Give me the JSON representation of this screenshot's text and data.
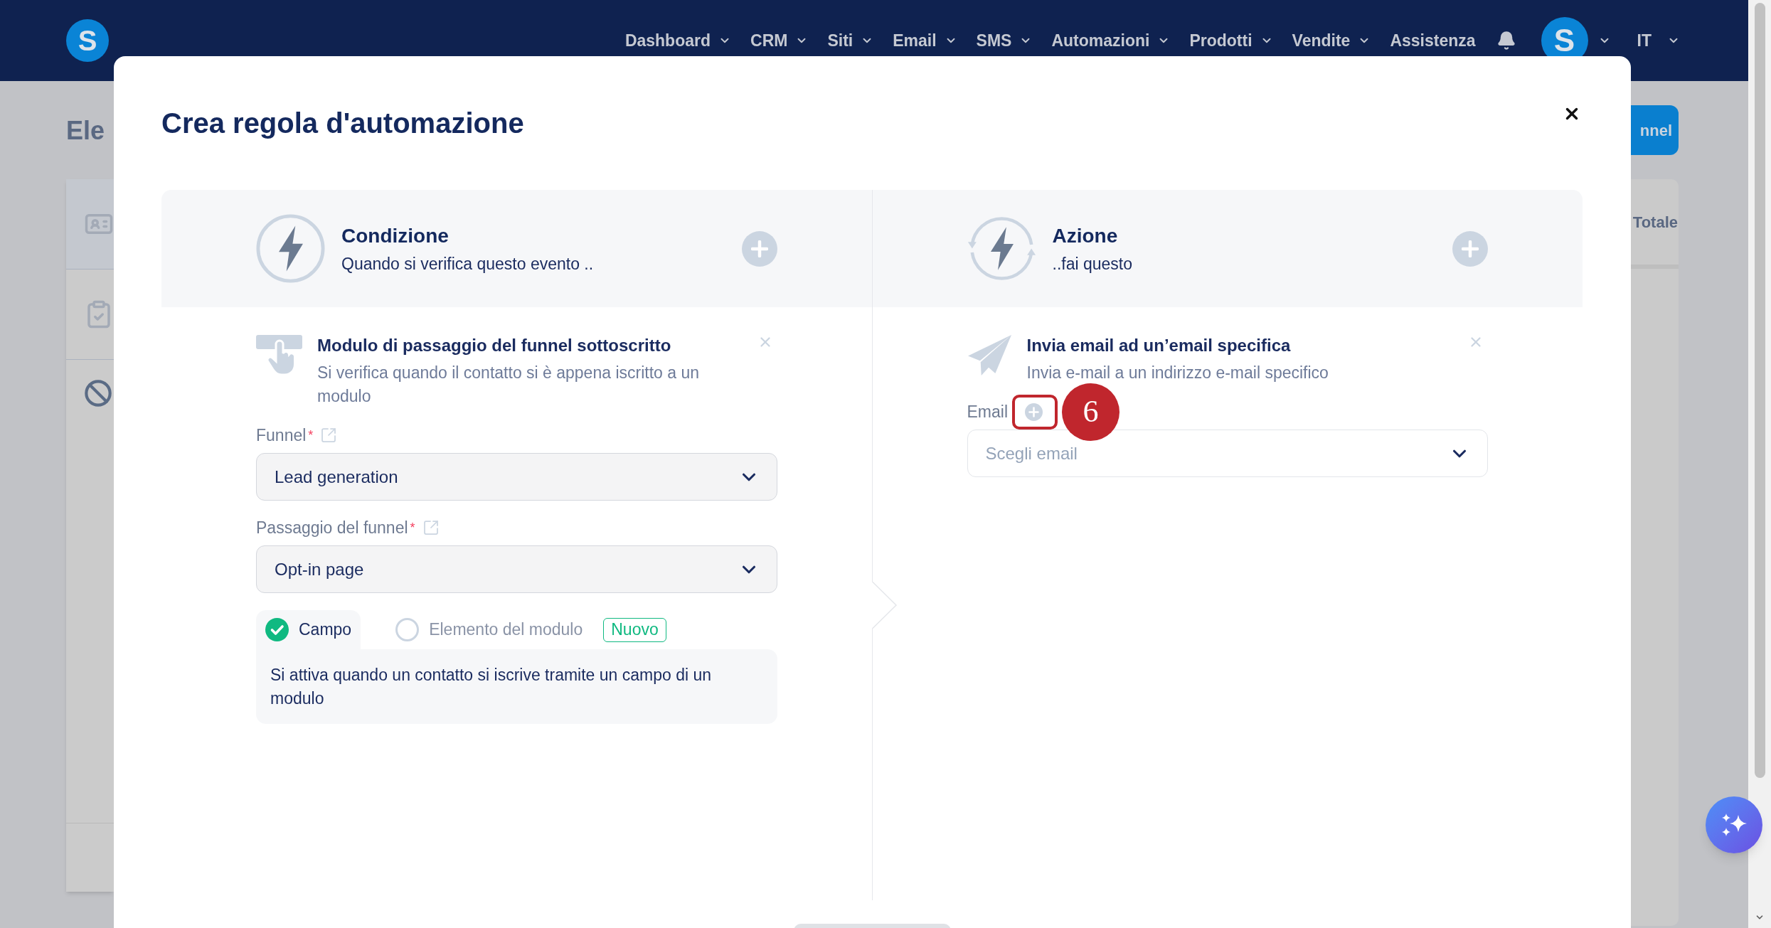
{
  "top_nav": {
    "logo": "S",
    "items": [
      {
        "label": "Dashboard",
        "dropdown": true
      },
      {
        "label": "CRM",
        "dropdown": true
      },
      {
        "label": "Siti",
        "dropdown": true
      },
      {
        "label": "Email",
        "dropdown": true
      },
      {
        "label": "SMS",
        "dropdown": true
      },
      {
        "label": "Automazioni",
        "dropdown": true
      },
      {
        "label": "Prodotti",
        "dropdown": true
      },
      {
        "label": "Vendite",
        "dropdown": true
      },
      {
        "label": "Assistenza",
        "dropdown": false
      }
    ],
    "avatar": "S",
    "language": "IT"
  },
  "background_page": {
    "title": "Ele",
    "button": "nnel",
    "column_1": "Totale"
  },
  "modal": {
    "title": "Crea regola d'automazione",
    "columns": [
      {
        "kind": "condition",
        "heading": "Condizione",
        "subheading": "Quando si verifica questo evento ..",
        "card": {
          "kind": "form",
          "title": "Modulo di passaggio del funnel sottoscritto",
          "description": "Si verifica quando il contatto si è appena iscritto a un modulo"
        },
        "fields": [
          {
            "kind": "link",
            "label": "Funnel",
            "required_mark": "*",
            "value": "Lead generation"
          },
          {
            "kind": "link",
            "label": "Passaggio del funnel",
            "required_mark": "*",
            "value": "Opt-in page"
          }
        ],
        "options": [
          {
            "label": "Campo",
            "selected": true
          },
          {
            "label": "Elemento del modulo",
            "selected": false,
            "badge": "Nuovo"
          }
        ],
        "option_description": "Si attiva quando un contatto si iscrive tramite un campo di un modulo"
      },
      {
        "kind": "action",
        "heading": "Azione",
        "subheading": "..fai questo",
        "card": {
          "kind": "email",
          "title": "Invia email ad un’email specifica",
          "description": "Invia e-mail a un indirizzo e-mail specifico"
        },
        "fields": [
          {
            "kind": "add",
            "label": "Email",
            "placeholder": "Scegli email",
            "step_marker": "6"
          }
        ]
      }
    ]
  }
}
